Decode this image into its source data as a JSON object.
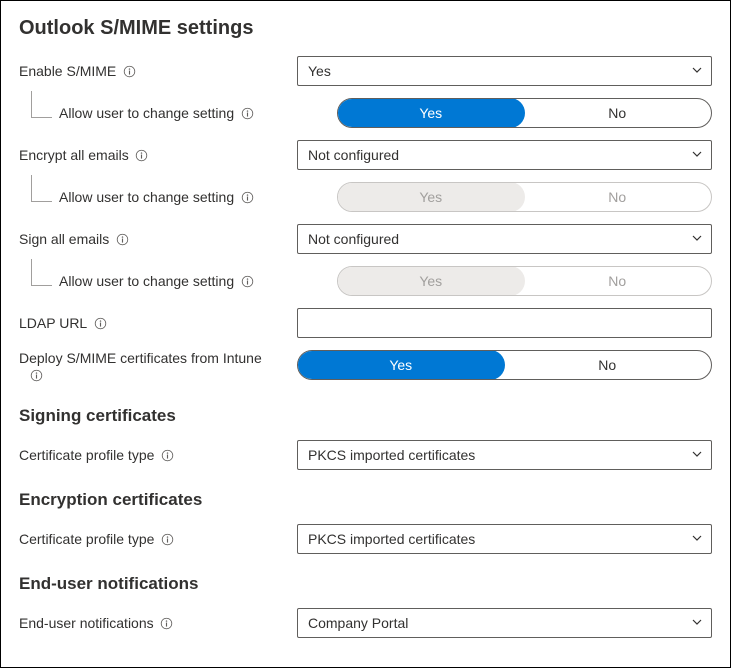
{
  "page": {
    "title": "Outlook S/MIME settings"
  },
  "toggle": {
    "yes": "Yes",
    "no": "No"
  },
  "settings": {
    "enable_smime": {
      "label": "Enable S/MIME",
      "value": "Yes",
      "allow_change_label": "Allow user to change setting",
      "allow_change_selected": "Yes"
    },
    "encrypt_all": {
      "label": "Encrypt all emails",
      "value": "Not configured",
      "allow_change_label": "Allow user to change setting",
      "allow_change_selected": "Yes"
    },
    "sign_all": {
      "label": "Sign all emails",
      "value": "Not configured",
      "allow_change_label": "Allow user to change setting",
      "allow_change_selected": "Yes"
    },
    "ldap_url": {
      "label": "LDAP URL",
      "value": ""
    },
    "deploy_certs": {
      "label": "Deploy S/MIME certificates from Intune",
      "selected": "Yes"
    }
  },
  "sections": {
    "signing": {
      "title": "Signing certificates",
      "profile_type_label": "Certificate profile type",
      "profile_type_value": "PKCS imported certificates"
    },
    "encryption": {
      "title": "Encryption certificates",
      "profile_type_label": "Certificate profile type",
      "profile_type_value": "PKCS imported certificates"
    },
    "notifications": {
      "title": "End-user notifications",
      "label": "End-user notifications",
      "value": "Company Portal"
    }
  }
}
